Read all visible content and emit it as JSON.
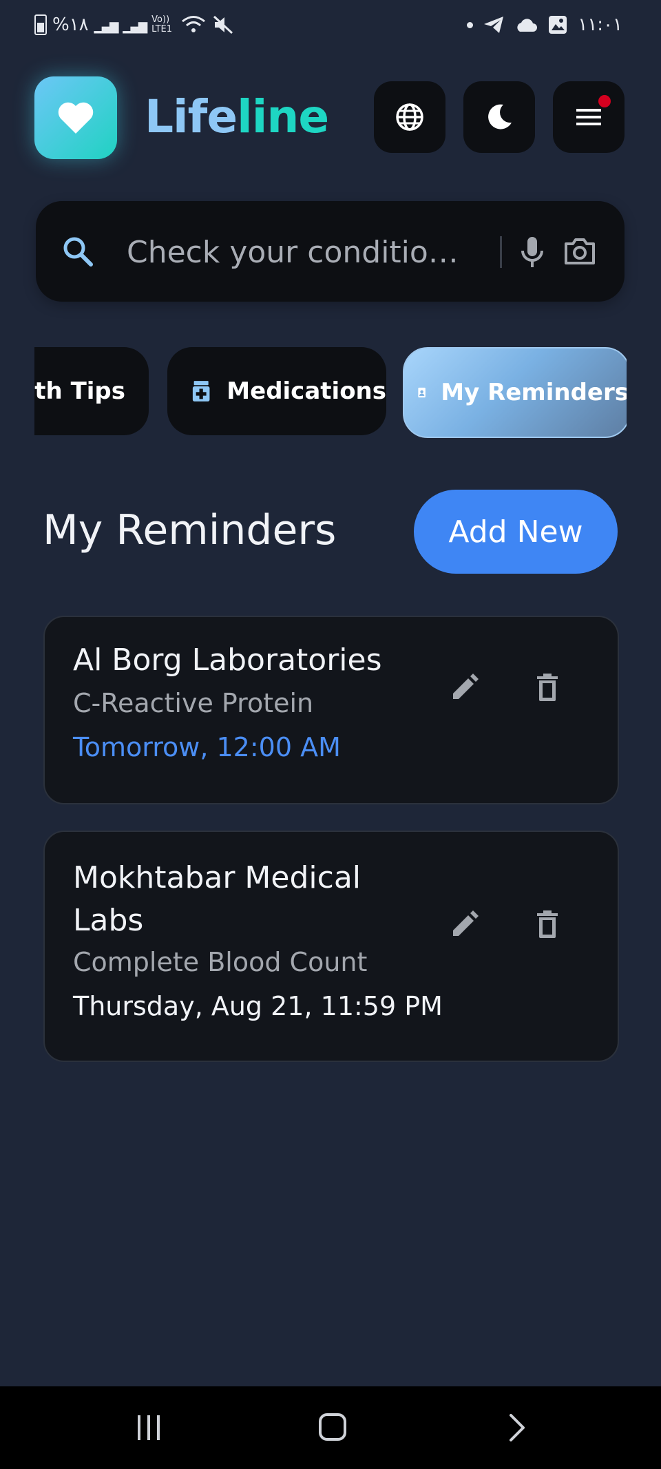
{
  "status_bar": {
    "battery_percent": "%١٨",
    "network": "Vo)) LTE1",
    "time": "١١:٠١",
    "icons": [
      "battery-icon",
      "signal-icon",
      "wifi-icon",
      "mute-icon",
      "telegram-icon",
      "cloud-icon",
      "gallery-icon"
    ]
  },
  "header": {
    "brand_part1": "Life",
    "brand_part2": "line",
    "buttons": [
      "globe-icon",
      "moon-icon",
      "menu-icon"
    ],
    "has_notification": true
  },
  "search": {
    "placeholder": "Check your conditio…"
  },
  "tabs": [
    {
      "label": "alth Tips",
      "icon": "health-tips-icon",
      "active": false
    },
    {
      "label": "Medications",
      "icon": "medicine-bottle-icon",
      "active": false
    },
    {
      "label": "My Reminders",
      "icon": "reminder-badge-icon",
      "active": true
    }
  ],
  "section": {
    "title": "My Reminders",
    "add_button": "Add New"
  },
  "reminders": [
    {
      "lab": "Al Borg Laboratories",
      "test": "C-Reactive Protein",
      "time": "Tomorrow, 12:00 AM",
      "time_color": "#4b8ef5"
    },
    {
      "lab_line1": "Mokhtabar Medical",
      "lab_line2": "Labs",
      "test": "Complete Blood Count",
      "time": "Thursday, Aug 21, 11:59 PM",
      "time_color": "#f1f3f7"
    }
  ],
  "colors": {
    "background": "#1e2638",
    "accent_blue": "#3f86f4",
    "brand_teal": "#1ed6c3",
    "brand_light_blue": "#8ec7f5"
  }
}
